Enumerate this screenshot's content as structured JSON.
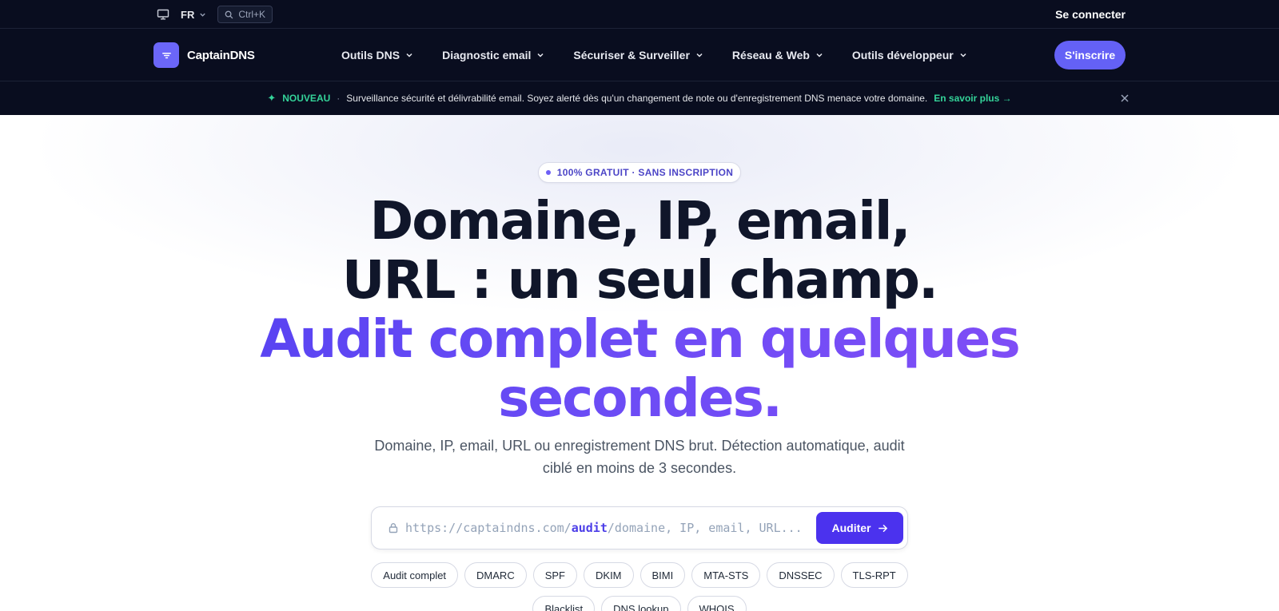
{
  "utility_bar": {
    "language": "FR",
    "search_shortcut": "Ctrl+K",
    "login_label": "Se connecter"
  },
  "nav": {
    "brand": "CaptainDNS",
    "items": [
      {
        "label": "Outils DNS"
      },
      {
        "label": "Diagnostic email"
      },
      {
        "label": "Sécuriser & Surveiller"
      },
      {
        "label": "Réseau & Web"
      },
      {
        "label": "Outils développeur"
      }
    ],
    "signup_label": "S'inscrire"
  },
  "announcement": {
    "tag": "NOUVEAU",
    "separator": "·",
    "message": "Surveillance sécurité et délivrabilité email. Soyez alerté dès qu'un changement de note ou d'enregistrement DNS menace votre domaine.",
    "link_label": "En savoir plus →"
  },
  "hero": {
    "badge": "100% GRATUIT · SANS INSCRIPTION",
    "headline_line1": "Domaine, IP, email,",
    "headline_line2": "URL : un seul champ.",
    "headline_accent_line1": "Audit complet en quelques",
    "headline_accent_line2": "secondes.",
    "subtitle": "Domaine, IP, email, URL ou enregistrement DNS brut. Détection automatique, audit ciblé en moins de 3 secondes."
  },
  "search": {
    "url_prefix": "https://captaindns.com/",
    "url_highlight": "audit",
    "url_placeholder": "/domaine, IP, email, URL...",
    "button_label": "Auditer"
  },
  "chips_row1": [
    "Audit complet",
    "DMARC",
    "SPF",
    "DKIM",
    "BIMI",
    "MTA-STS",
    "DNSSEC",
    "TLS-RPT"
  ],
  "chips_row2": [
    "Blacklist",
    "DNS lookup",
    "WHOIS"
  ],
  "colors": {
    "nav_bg": "#090d1f",
    "accent": "#6461f6",
    "button": "#4b32ee",
    "announcement_green": "#34d399",
    "headline_dark": "#10162a"
  }
}
